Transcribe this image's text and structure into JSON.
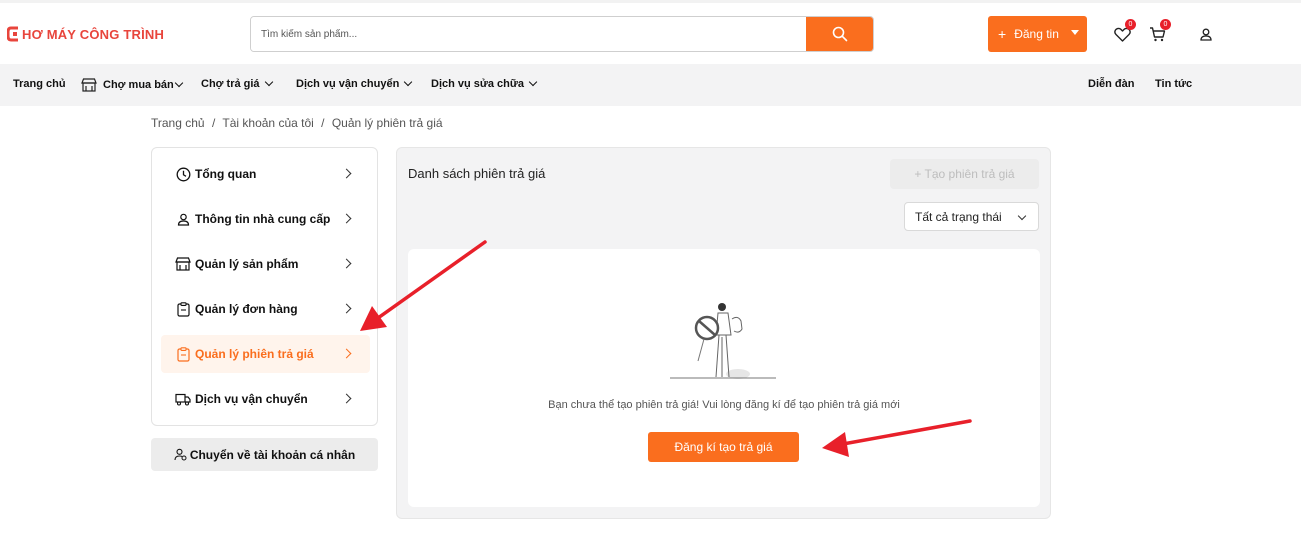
{
  "header": {
    "logo_text": "HƠ MÁY CÔNG TRÌNH",
    "search_placeholder": "Tìm kiếm sản phẩm...",
    "post_label": "Đăng tin",
    "wishlist_count": "0",
    "cart_count": "0"
  },
  "nav": {
    "items": [
      "Trang chủ",
      "Chợ mua bán",
      "Chợ trả giá",
      "Dịch vụ vận chuyển",
      "Dịch vụ sửa chữa"
    ],
    "right_items": [
      "Diễn đàn",
      "Tin tức"
    ]
  },
  "breadcrumb": [
    "Trang chủ",
    "/",
    "Tài khoản của tôi",
    "/",
    "Quản lý phiên trả giá"
  ],
  "sidebar": {
    "items": [
      {
        "label": "Tổng quan",
        "icon": "clock-icon"
      },
      {
        "label": "Thông tin nhà cung cấp",
        "icon": "user-icon"
      },
      {
        "label": "Quản lý sản phẩm",
        "icon": "store-icon"
      },
      {
        "label": "Quản lý đơn hàng",
        "icon": "clipboard-icon"
      },
      {
        "label": "Quản lý phiên trả giá",
        "icon": "clipboard-icon",
        "active": true
      },
      {
        "label": "Dịch vụ vận chuyển",
        "icon": "truck-icon"
      }
    ],
    "switch_label": "Chuyển về tài khoản cá nhân"
  },
  "main": {
    "title": "Danh sách phiên trả giá",
    "create_label": "+ Tạo phiên trả giá",
    "status_selected": "Tất cả trạng thái",
    "empty_message": "Bạn chưa thể tạo phiên trả giá! Vui lòng đăng kí để tạo phiên trả giá mới",
    "register_label": "Đăng kí tạo trả giá"
  },
  "colors": {
    "accent": "#fa6e1e",
    "brand": "#e8453c",
    "annotation_arrow": "#e8202a"
  }
}
